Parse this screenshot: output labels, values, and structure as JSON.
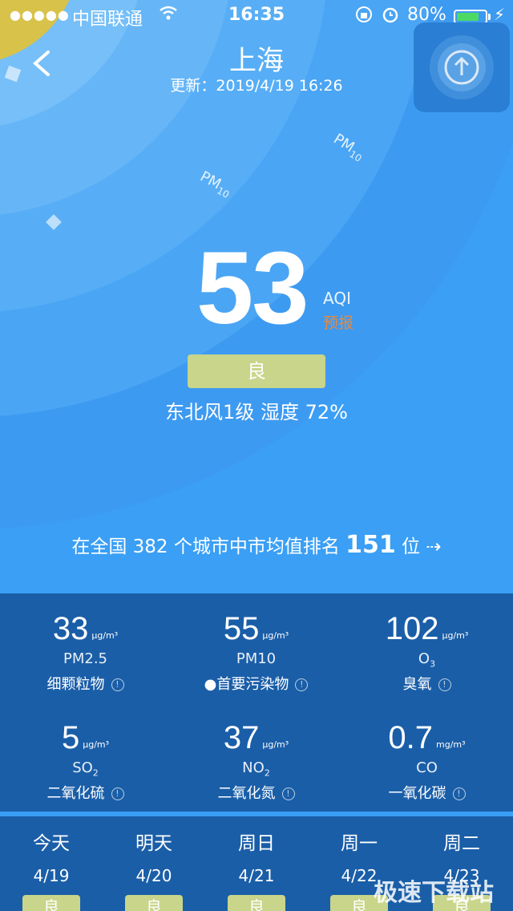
{
  "status_bar": {
    "signal_dots": "●●●●●",
    "carrier": "中国联通",
    "time": "16:35",
    "battery": "80%",
    "battery_level": 0.8
  },
  "header": {
    "city": "上海",
    "updated": "更新：2019/4/19 16:26"
  },
  "aqi": {
    "value": "53",
    "label": "AQI",
    "forecast": "预报",
    "level": "良",
    "level_color": "#c8d58a"
  },
  "weather": {
    "text": "东北风1级   湿度 72%"
  },
  "ranking": {
    "prefix": "在全国 382 个城市中市均值排名 ",
    "rank": "151",
    "suffix": " 位 ⇢"
  },
  "pollutants": [
    {
      "value": "33",
      "unit": "μg/m³",
      "code": "PM2.5",
      "code_sub": "",
      "name": "细颗粒物"
    },
    {
      "value": "55",
      "unit": "μg/m³",
      "code": "PM10",
      "code_sub": "",
      "name": "●首要污染物"
    },
    {
      "value": "102",
      "unit": "μg/m³",
      "code": "O",
      "code_sub": "3",
      "name": "臭氧"
    },
    {
      "value": "5",
      "unit": "μg/m³",
      "code": "SO",
      "code_sub": "2",
      "name": "二氧化硫"
    },
    {
      "value": "37",
      "unit": "μg/m³",
      "code": "NO",
      "code_sub": "2",
      "name": "二氧化氮"
    },
    {
      "value": "0.7",
      "unit": "mg/m³",
      "code": "CO",
      "code_sub": "",
      "name": "一氧化碳"
    }
  ],
  "forecast": [
    {
      "name": "今天",
      "date": "4/19",
      "level": "良"
    },
    {
      "name": "明天",
      "date": "4/20",
      "level": "良"
    },
    {
      "name": "周日",
      "date": "4/21",
      "level": "良"
    },
    {
      "name": "周一",
      "date": "4/22",
      "level": "良"
    },
    {
      "name": "周二",
      "date": "4/23",
      "level": "良"
    }
  ],
  "pm_labels": [
    "PM",
    "10"
  ],
  "watermark": "极速下载站",
  "colors": {
    "background": "#3a9ff5",
    "panel": "#1a5ea8",
    "level_good": "#c8d58a",
    "forecast_accent": "#e8893a",
    "sun": "#d8c24a"
  }
}
